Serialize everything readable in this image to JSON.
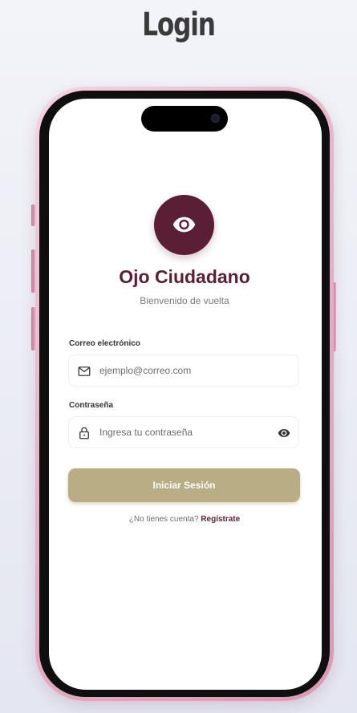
{
  "heading": "Login",
  "app": {
    "title": "Ojo Ciudadano",
    "subtitle": "Bienvenido de vuelta",
    "brand_color": "#5a1f35",
    "accent_color": "#b8ad84"
  },
  "form": {
    "email": {
      "label": "Correo electrónico",
      "placeholder": "ejemplo@correo.com",
      "value": "",
      "icon": "mail-icon"
    },
    "password": {
      "label": "Contraseña",
      "placeholder": "Ingresa tu contraseña",
      "value": "",
      "icon": "lock-icon",
      "toggle_icon": "eye-icon"
    },
    "submit_label": "Iniciar Sesión"
  },
  "signup": {
    "prompt": "¿No tienes cuenta?",
    "link": "Regístrate"
  }
}
